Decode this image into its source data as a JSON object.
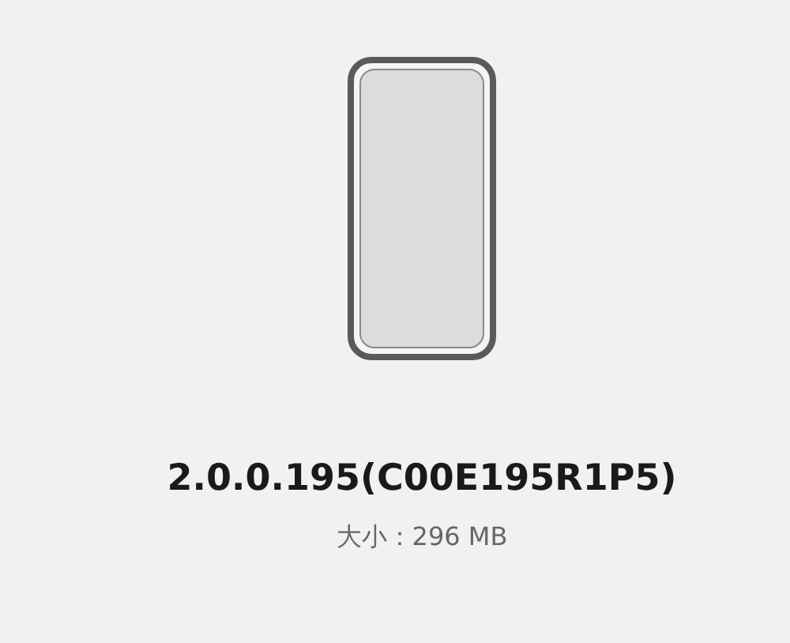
{
  "version": "2.0.0.195(C00E195R1P5)",
  "size": "大小：296 MB"
}
